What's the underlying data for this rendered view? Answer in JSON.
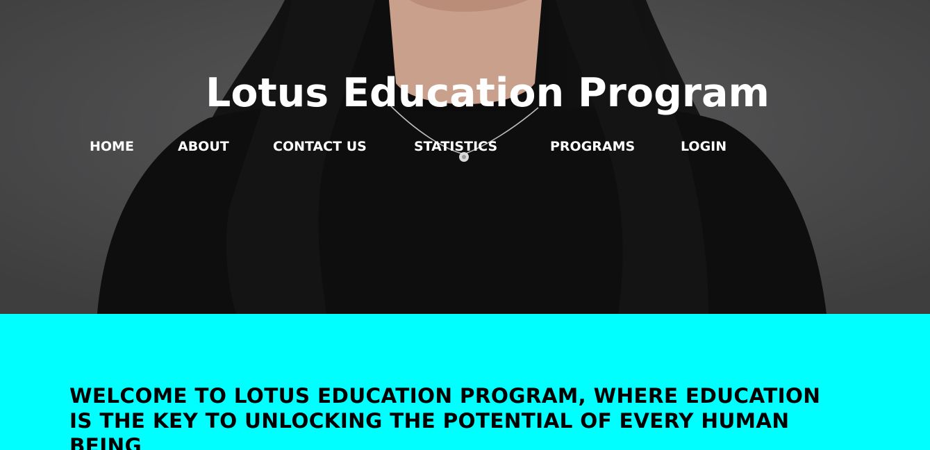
{
  "header": {
    "title": "Lotus Education Program"
  },
  "nav": {
    "items": [
      {
        "label": "HOME"
      },
      {
        "label": "ABOUT"
      },
      {
        "label": "CONTACT US"
      },
      {
        "label": "STATISTICS"
      },
      {
        "label": "PROGRAMS"
      },
      {
        "label": "LOGIN"
      }
    ]
  },
  "hero": {
    "image": "portrait-of-woman-in-black-top"
  },
  "welcome": {
    "text": "WELCOME TO LOTUS EDUCATION PROGRAM, WHERE EDUCATION IS THE KEY TO UNLOCKING THE POTENTIAL OF EVERY HUMAN BEING"
  },
  "colors": {
    "welcome_background": "#00ffff",
    "nav_text": "#ffffff",
    "title_text": "#ffffff",
    "welcome_text": "#000000"
  }
}
